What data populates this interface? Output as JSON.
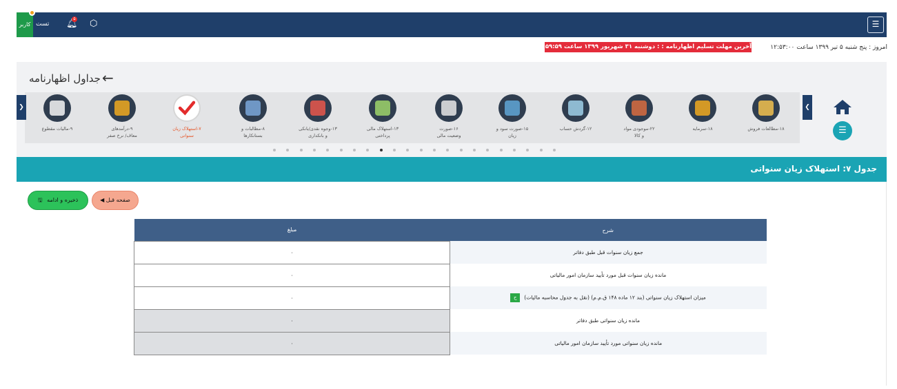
{
  "topbar": {
    "menu_icon": "menu-icon",
    "user_badge": "کاربر",
    "user_name": "تست",
    "notification_count": "۵",
    "bell_icon": "bell-icon",
    "cube_icon": "cube-icon"
  },
  "info": {
    "date_text": "امروز : پنج شنبه ۵ تیر ۱۳۹۹ ساعت ۱۲:۵۳:۰۰",
    "deadline_text": "آخرین مهلت تسلیم اظهارنامه : : دوشنبه ۳۱ شهریور ۱۳۹۹ ساعت ۱۱:۵۹:۵۹ ب.ظ"
  },
  "page": {
    "title": "جداول اظهارنامه"
  },
  "carousel": {
    "items": [
      {
        "label": "۱۸-مطالعات فروش",
        "label2": "",
        "icon": "person-info-icon"
      },
      {
        "label": "۱۸-سرمایه",
        "label2": "",
        "icon": "money-bag-icon"
      },
      {
        "label": "۲۲-موجودی مواد",
        "label2": "و کالا",
        "icon": "inventory-icon"
      },
      {
        "label": "۱۲-گردش حساب",
        "label2": "",
        "icon": "account-flow-icon"
      },
      {
        "label": "۱۵-صورت سود و",
        "label2": "زیان",
        "icon": "scale-icon"
      },
      {
        "label": "۱۶-صورت",
        "label2": "وضعیت مالی",
        "icon": "calculator-icon"
      },
      {
        "label": "۱۳-استهلاک مالی",
        "label2": "پرداختی",
        "icon": "money-icon"
      },
      {
        "label": "۱۳-وجوه نقدی/بانکی",
        "label2": "و بانکداری",
        "icon": "cash-register-icon"
      },
      {
        "label": "۸-مطالبات و",
        "label2": "بستانکارها",
        "icon": "id-card-icon"
      },
      {
        "label": "۷-استهلاک زیان",
        "label2": "سنواتی",
        "icon": "checkmark-icon",
        "active": true
      },
      {
        "label": "۹-درآمدهای",
        "label2": "معاف/ نرخ صفر",
        "icon": "chart-coins-icon"
      },
      {
        "label": "۹-مالیات مقطوع",
        "label2": "",
        "icon": "document-list-icon"
      }
    ],
    "dots": 22,
    "active_dot": 8
  },
  "section": {
    "title": "جدول ۷: استهلاک زیان سنواتی"
  },
  "buttons": {
    "save_label": "ذخیره و ادامه",
    "prev_label": "صفحه قبل"
  },
  "table": {
    "headers": {
      "desc": "شرح",
      "amount": "مبلغ"
    },
    "rows": [
      {
        "desc": "جمع زیان سنوات قبل طبق دفاتر",
        "amount": "۰",
        "readonly": false,
        "calc": false
      },
      {
        "desc": "مانده زیان سنوات قبل مورد تأیید سازمان امور مالیاتی",
        "amount": "۰",
        "readonly": false,
        "calc": false
      },
      {
        "desc": "میزان استهلاک زیان سنواتی (بند ۱۲ ماده ۱۴۸ ق.م.م) (نقل به جدول محاسبه مالیات)",
        "amount": "۰",
        "readonly": false,
        "calc": true,
        "calc_label": "ح"
      },
      {
        "desc": "مانده زیان سنواتی طبق دفاتر",
        "amount": "۰",
        "readonly": true,
        "calc": false
      },
      {
        "desc": "مانده زیان سنواتی مورد تأیید سازمان امور مالیاتی",
        "amount": "۰",
        "readonly": true,
        "calc": false
      }
    ]
  }
}
